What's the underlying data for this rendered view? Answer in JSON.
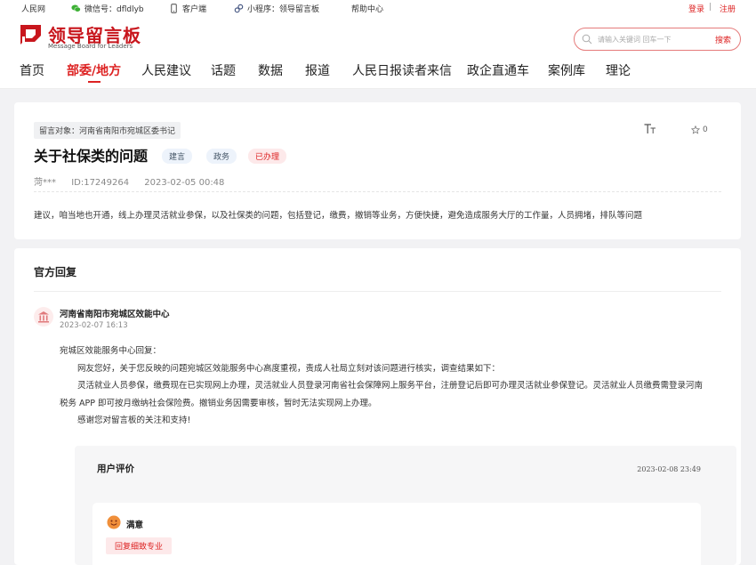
{
  "topbar": {
    "site": "人民网",
    "wechat": "微信号：dfldlyb",
    "app": "客户端",
    "miniprogram": "小程序：领导留言板",
    "help": "帮助中心",
    "login": "登录",
    "separator": "|",
    "register": "注册"
  },
  "brand": {
    "name_cn": "领导留言板",
    "name_en": "Message Board for Leaders"
  },
  "search": {
    "placeholder": "请输入关键词 回车一下",
    "button": "搜索"
  },
  "nav": {
    "items": [
      "首页",
      "部委/地方",
      "人民建议",
      "话题",
      "数据",
      "报道",
      "人民日报读者来信",
      "政企直通车",
      "案例库",
      "理论"
    ],
    "active": "部委/地方"
  },
  "message": {
    "target": "留言对象：河南省南阳市宛城区委书记",
    "title": "关于社保类的问题",
    "tags": [
      "建言",
      "政务",
      "已办理"
    ],
    "fav_count": "0",
    "author": "菏***",
    "id": "ID:17249264",
    "time": "2023-02-05 00:48",
    "content": "建议，咱当地也开通，线上办理灵活就业参保，以及社保类的问题，包括登记，缴费，撤销等业务，方便快捷，避免造成服务大厅的工作量，人员拥堵，排队等问题"
  },
  "reply": {
    "heading": "官方回复",
    "org": "河南省南阳市宛城区效能中心",
    "time": "2023-02-07 16:13",
    "lines": [
      "宛城区效能服务中心回复：",
      "网友您好，关于您反映的问题宛城区效能服务中心高度重视，责成人社局立刻对该问题进行核实，调查结果如下：",
      "灵活就业人员参保，缴费现在已实现网上办理，灵活就业人员登录河南省社会保障网上服务平台，注册登记后即可办理灵活就业参保登记。灵活就业人员缴费需登录河南",
      "税务 APP 即可按月缴纳社会保险费。撤销业务因需要审核，暂时无法实现网上办理。",
      "感谢您对留言板的关注和支持!"
    ]
  },
  "evaluation": {
    "heading": "用户评价",
    "time": "2023-02-08 23:49",
    "rating": "满意",
    "feedback": "回复细致专业"
  },
  "colors": {
    "accent": "#d22222",
    "brand": "#c8161d"
  }
}
